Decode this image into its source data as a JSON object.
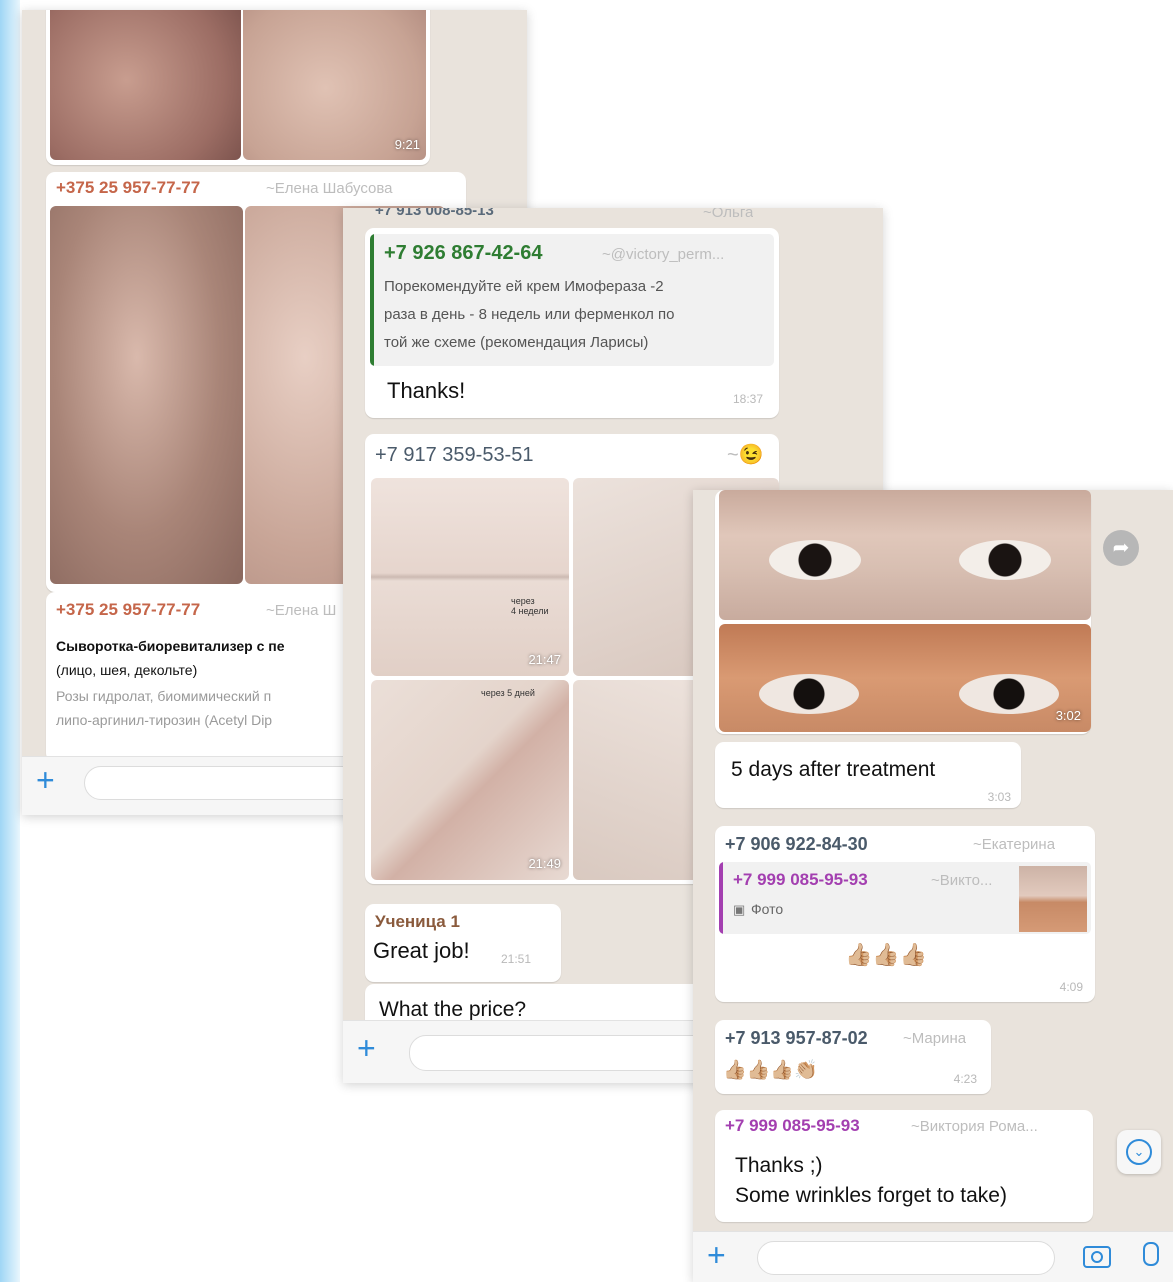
{
  "shot1": {
    "top_photo_time": "9:21",
    "msg1": {
      "phone": "+375 25 957-77-77",
      "alias": "~Елена Шабусова"
    },
    "msg2": {
      "phone": "+375 25 957-77-77",
      "alias": "~Елена Ш",
      "title": "Сыворотка-биоревитализер с пе",
      "subtitle": "(лицо, шея, декольте)",
      "line1": "Розы гидролат, биомимический п",
      "line2": "липо-аргинил-тирозин (Acetyl Dip"
    }
  },
  "shot2": {
    "cut_header_phone": "+7 913 008-85-13",
    "cut_header_alias": "~Ольга",
    "reply": {
      "quoted_phone": "+7 926 867-42-64",
      "quoted_alias": "~@victory_perm...",
      "quoted_line1": "Порекомендуйте ей крем Имофераза -2",
      "quoted_line2": "раза в день - 8 недель или ферменкол по",
      "quoted_line3": "той же схеме (рекомендация  Ларисы)",
      "text": "Thanks!",
      "time": "18:37"
    },
    "album": {
      "phone": "+7 917 359-53-51",
      "alias": "~😉",
      "caption_small_1": "через\n4 недели",
      "caption_small_2": "через 5 дней",
      "time1": "21:47",
      "time2": "21:49"
    },
    "reply2": {
      "sender": "Ученица 1",
      "text": "Great job!",
      "time": "21:51"
    },
    "last_text": "What the price?"
  },
  "shot3": {
    "photo_time": "3:02",
    "msg1": {
      "text": "5 days after treatment",
      "time": "3:03"
    },
    "msg2": {
      "phone": "+7 906 922-84-30",
      "alias": "~Екатерина",
      "quoted_phone": "+7 999 085-95-93",
      "quoted_alias": "~Викто...",
      "quoted_label": "Фото",
      "emoji": "👍🏼👍🏼👍🏼",
      "time": "4:09"
    },
    "msg3": {
      "phone": "+7 913 957-87-02",
      "alias": "~Марина",
      "emoji": "👍🏼👍🏼👍🏼👏🏼",
      "time": "4:23"
    },
    "msg4": {
      "phone": "+7 999 085-95-93",
      "alias": "~Виктория Рома...",
      "line1": "Thanks ;)",
      "line2": "Some wrinkles forget to take)"
    }
  },
  "colors": {
    "chat_bg": "#e9e3dc",
    "accent_blue": "#2f8bd9",
    "sender_orange": "#c5664a",
    "sender_green": "#2e7d32",
    "sender_purple": "#a33fb0",
    "sender_slate": "#4a5a6a"
  },
  "icons": [
    "plus-icon",
    "camera-icon",
    "microphone-icon",
    "forward-icon",
    "scroll-down-icon",
    "photo-icon"
  ]
}
